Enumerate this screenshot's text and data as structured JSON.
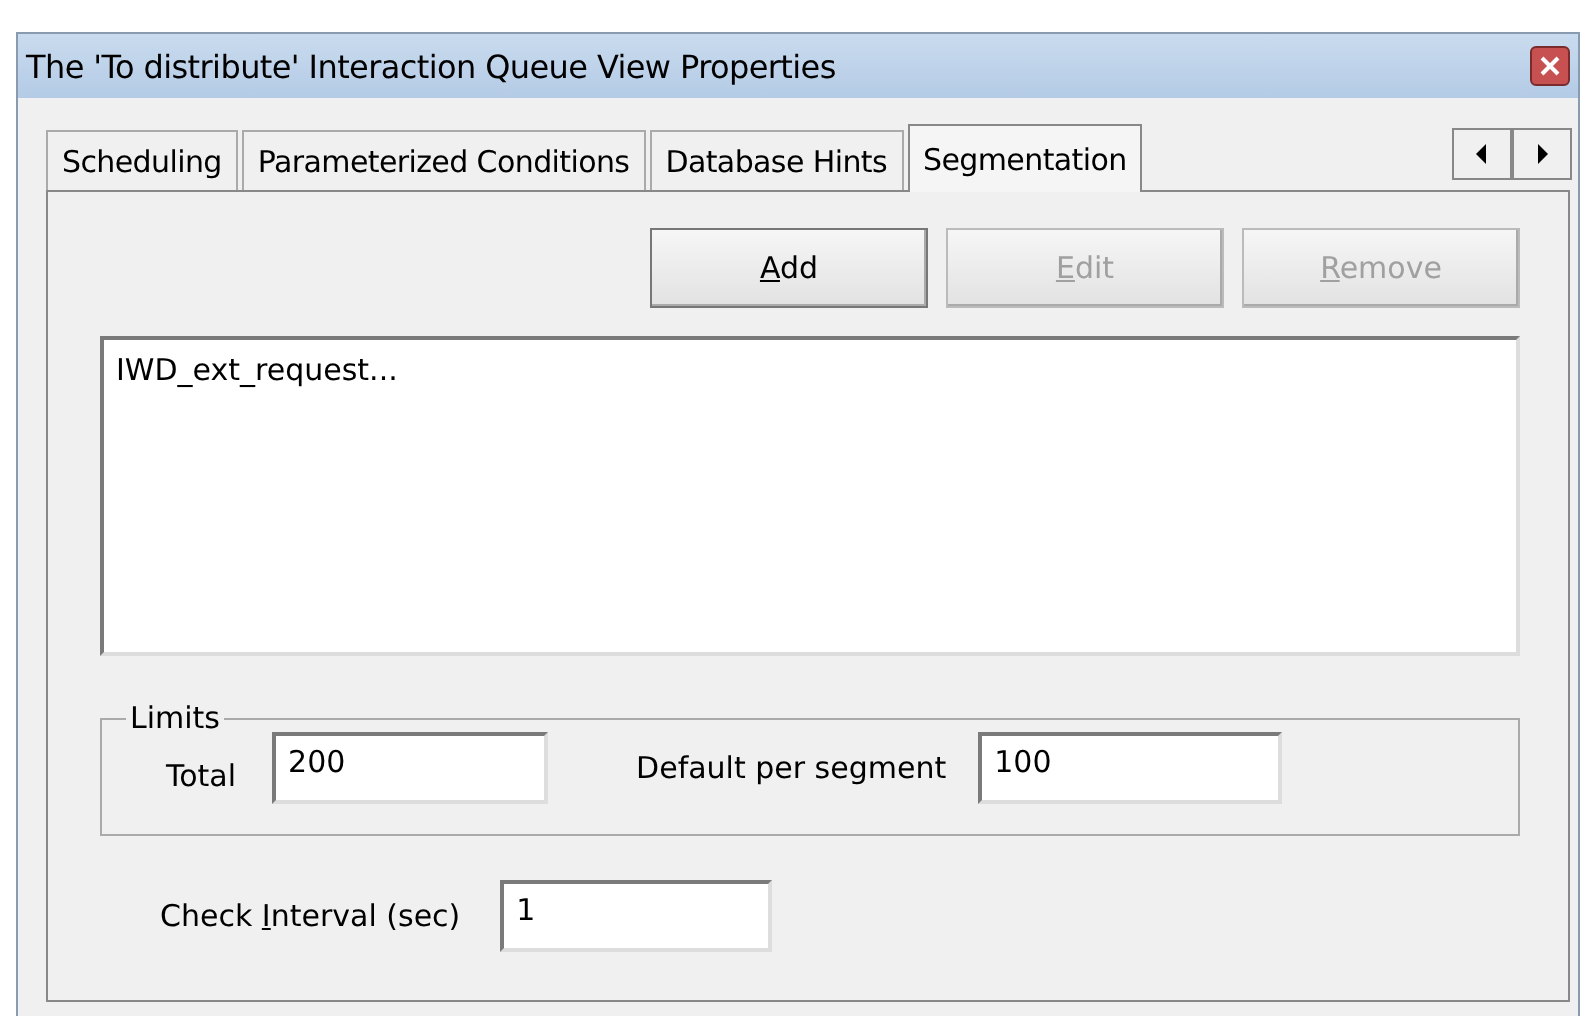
{
  "window": {
    "title": "The 'To distribute' Interaction Queue View Properties"
  },
  "tabs": [
    {
      "label": "Scheduling",
      "selected": false
    },
    {
      "label": "Parameterized Conditions",
      "selected": false
    },
    {
      "label": "Database Hints",
      "selected": false
    },
    {
      "label": "Segmentation",
      "selected": true
    }
  ],
  "buttons": [
    {
      "key": "A",
      "post": "dd",
      "disabled": false
    },
    {
      "key": "E",
      "post": "dit",
      "disabled": true
    },
    {
      "key": "R",
      "post": "emove",
      "disabled": true
    }
  ],
  "list": {
    "items": [
      "IWD_ext_request..."
    ]
  },
  "limits": {
    "title": "Limits",
    "total_label": "Total",
    "total_value": "200",
    "per_segment_label": "Default per segment",
    "per_segment_value": "100"
  },
  "check_interval": {
    "pre": "Check ",
    "key": "I",
    "post": "nterval (sec)",
    "value": "1"
  }
}
